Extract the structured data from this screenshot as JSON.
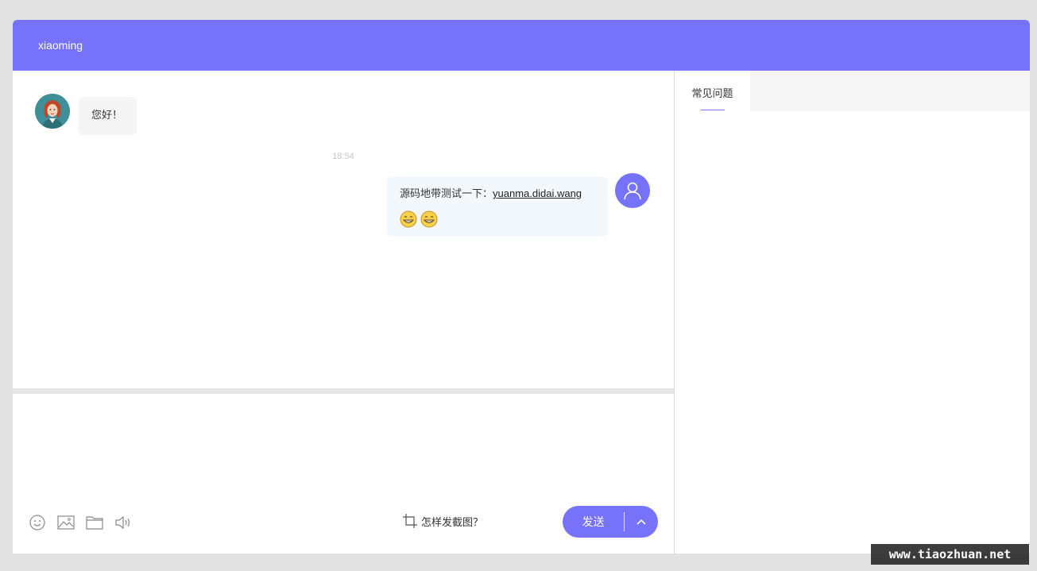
{
  "header": {
    "title": "xiaoming"
  },
  "colors": {
    "accent": "#7672f9",
    "background": "#e2e2e2",
    "agent_bubble": "#f5f5f5",
    "user_bubble": "#f3f8fd"
  },
  "messages": {
    "agent": {
      "text": "您好！",
      "avatar": "female-agent-avatar"
    },
    "time": "18:54",
    "user": {
      "text": "源码地带测试一下：",
      "link": "yuanma.didai.wang",
      "emojis": [
        "grin-emoji",
        "grin-emoji"
      ],
      "avatar": "user-icon"
    }
  },
  "toolbar": {
    "icons": [
      "smile-icon",
      "image-icon",
      "folder-icon",
      "speaker-icon"
    ],
    "screenshot_help": "怎样发截图？",
    "send_label": "发送"
  },
  "side": {
    "tab": "常见问题"
  },
  "watermark": "www.tiaozhuan.net"
}
